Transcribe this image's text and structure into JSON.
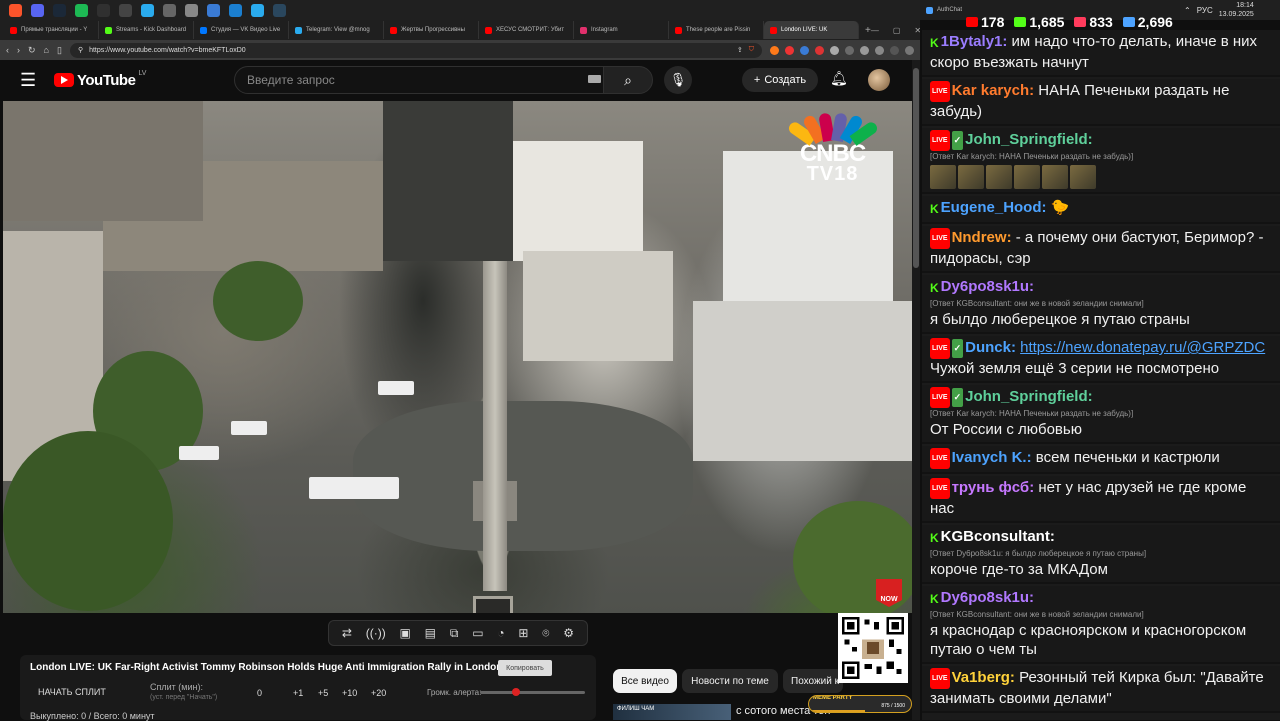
{
  "taskbar": {
    "icons": [
      {
        "name": "brave-icon",
        "color": "#fb542b"
      },
      {
        "name": "discord-icon",
        "color": "#5865f2"
      },
      {
        "name": "steam-icon",
        "color": "#1b2838"
      },
      {
        "name": "spotify-icon",
        "color": "#1db954"
      },
      {
        "name": "obs-icon",
        "color": "#303030"
      },
      {
        "name": "app-icon",
        "color": "#444"
      },
      {
        "name": "telegram-icon",
        "color": "#2aabee"
      },
      {
        "name": "app2-icon",
        "color": "#666"
      },
      {
        "name": "app3-icon",
        "color": "#888"
      },
      {
        "name": "app4-icon",
        "color": "#3a7bd5"
      },
      {
        "name": "app5-icon",
        "color": "#1b7fd0"
      },
      {
        "name": "app6-icon",
        "color": "#2aabee"
      },
      {
        "name": "steam2-icon",
        "color": "#2a475e"
      }
    ],
    "lang": "РУС",
    "time": "18:14",
    "date": "13.09.2025"
  },
  "browser": {
    "tabs": [
      {
        "title": "Прямые трансляции - Y",
        "color": "#ff0000",
        "active": false
      },
      {
        "title": "Streams - Kick Dashboard",
        "color": "#53fc18",
        "active": false
      },
      {
        "title": "Студия — VK Видео Live",
        "color": "#0077ff",
        "active": false
      },
      {
        "title": "Telegram: View @mnog",
        "color": "#2aabee",
        "active": false
      },
      {
        "title": "Жертвы Прогрессивны",
        "color": "#ff0000",
        "active": false
      },
      {
        "title": "ХЕСУС СМОТРИТ: Убит",
        "color": "#ff0000",
        "active": false
      },
      {
        "title": "Instagram",
        "color": "#e1306c",
        "active": false
      },
      {
        "title": "These people are Pissin",
        "color": "#ff0000",
        "active": false
      },
      {
        "title": "London LIVE: UK",
        "color": "#ff0000",
        "active": true
      }
    ],
    "url": "https://www.youtube.com/watch?v=bmeKFTLoxD0"
  },
  "youtube": {
    "logo": "YouTube",
    "region": "LV",
    "search_placeholder": "Введите запрос",
    "create_label": "Создать",
    "video_watermark_1": "CNBC",
    "video_watermark_2": "TV18",
    "now_badge": "NOW",
    "video_title": "London LIVE: UK Far-Right Activist Tommy Robinson Holds Huge Anti Immigration Rally in London | N18G",
    "copy_label": "Копировать",
    "chips": [
      "Все видео",
      "Новости по теме",
      "Похожий к"
    ],
    "rec_title": "с сотого места тон",
    "rec_thumb_text": "ФИЛИШ ЧАМ"
  },
  "split_panel": {
    "start_label": "НАЧАТЬ СПЛИТ",
    "split_label": "Сплит (мин):",
    "split_hint": "(уст. перед \"Начать\")",
    "values": [
      "0",
      "+1",
      "+5",
      "+10",
      "+20"
    ],
    "volume_label": "Громк. алерта:",
    "volume_level": 0.3,
    "status": "Выкуплено: 0 / Всего: 0 минут"
  },
  "meme_party": {
    "label": "MEME PARTY",
    "count": "875 / 1500"
  },
  "chat_header": {
    "title": "AuthChat",
    "stats": [
      {
        "platform": "youtube",
        "value": "178",
        "color": "#ff0000"
      },
      {
        "platform": "kick",
        "value": "1,685",
        "color": "#53fc18"
      },
      {
        "platform": "vk-live",
        "value": "833",
        "color": "#ff3b5c"
      },
      {
        "platform": "viewers",
        "value": "2,696",
        "color": "#4da3ff"
      }
    ]
  },
  "chat": [
    {
      "badges": [
        "k"
      ],
      "nick": "1Bytaly1:",
      "nick_color": "#9b7dff",
      "text": "им надо что-то делать, иначе в них скоро въезжать начнут"
    },
    {
      "badges": [
        "yt"
      ],
      "nick": "Kar karych:",
      "nick_color": "#ff7b2e",
      "text": "НАНА Печеньки раздать не забудь)"
    },
    {
      "badges": [
        "yt",
        "ck"
      ],
      "nick": "John_Springfield:",
      "nick_color": "#5fd09b",
      "reply": "[Ответ Kar karych: НАНА Печеньки раздать не забудь)]",
      "emotes": 6,
      "text": ""
    },
    {
      "badges": [
        "k"
      ],
      "nick": "Eugene_Hood:",
      "nick_color": "#4da3ff",
      "text": "🐤"
    },
    {
      "badges": [
        "yt"
      ],
      "nick": "Nndrew:",
      "nick_color": "#ff9a2e",
      "text": "- а почему они бастуют, Беримор? - пидорасы, сэр"
    },
    {
      "badges": [
        "k"
      ],
      "nick": "Dy6po8sk1u:",
      "nick_color": "#b178ff",
      "reply": "[Ответ KGBconsultant: они же в новой зеландии снимали]",
      "text": "я былдо люберецкое я путаю страны"
    },
    {
      "badges": [
        "yt",
        "ck"
      ],
      "nick": "Dunck:",
      "nick_color": "#4da3ff",
      "link": "https://new.donatepay.ru/@GRPZDC",
      "text": "Чужой земля ещё 3 серии не посмотрено"
    },
    {
      "badges": [
        "yt",
        "ck"
      ],
      "nick": "John_Springfield:",
      "nick_color": "#5fd09b",
      "reply": "[Ответ Kar karych: НАНА Печеньки раздать не забудь)]",
      "text": "От России с любовью"
    },
    {
      "badges": [
        "yt"
      ],
      "nick": "Ivanych K.:",
      "nick_color": "#4da3ff",
      "text": "всем печеньки и кастрюли"
    },
    {
      "badges": [
        "yt"
      ],
      "nick": "трунь фсб:",
      "nick_color": "#c678ff",
      "text": "нет у нас друзей не где кроме нас"
    },
    {
      "badges": [
        "k"
      ],
      "nick": "KGBconsultant:",
      "nick_color": "#ffffff",
      "reply": "[Ответ Dy6po8sk1u: я былдо люберецкое я путаю страны]",
      "text": "короче где-то за МКАДом"
    },
    {
      "badges": [
        "k"
      ],
      "nick": "Dy6po8sk1u:",
      "nick_color": "#b178ff",
      "reply": "[Ответ KGBconsultant: они же в новой зеландии снимали]",
      "text": "я краснодар с красноярском и красногорском путаю о чем ты"
    },
    {
      "badges": [
        "yt"
      ],
      "nick": "Va1berg:",
      "nick_color": "#ffd23a",
      "text": "Резонный тей Кирка был: \"Давайте занимать своими делами\""
    }
  ]
}
